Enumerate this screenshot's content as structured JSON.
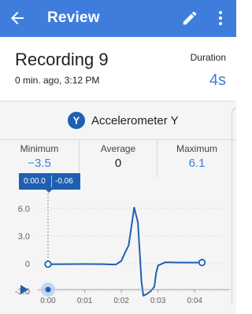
{
  "appbar": {
    "title": "Review",
    "back_icon": "arrow-back-icon",
    "edit_icon": "pencil-icon",
    "more_icon": "more-vert-icon",
    "color": "#3f7ddd"
  },
  "recording": {
    "title": "Recording 9",
    "time": "0 min. ago, 3:12 PM",
    "duration_label": "Duration",
    "duration_value": "4s"
  },
  "sensor": {
    "name": "Accelerometer Y",
    "icon_letter": "Y"
  },
  "stats": {
    "minimum_label": "Minimum",
    "minimum_value": "−3.5",
    "average_label": "Average",
    "average_value": "0",
    "maximum_label": "Maximum",
    "maximum_value": "6.1"
  },
  "tooltip": {
    "time": "0:00.0",
    "value": "-0.06"
  },
  "playback": {
    "play_icon": "play-icon",
    "position_seconds": 0
  },
  "chart_data": {
    "type": "line",
    "x_unit": "seconds",
    "x_tick_labels": [
      "0:00",
      "0:01",
      "0:02",
      "0:03",
      "0:04"
    ],
    "x_ticks": [
      0,
      1,
      2,
      3,
      4
    ],
    "y_tick_labels": [
      "6.0",
      "3.0",
      "0",
      "-3.0"
    ],
    "y_ticks": [
      6,
      3,
      0,
      -3
    ],
    "xlim": [
      0,
      4.5
    ],
    "ylim": [
      -4.2,
      7.2
    ],
    "grid": "horizontal-dotted",
    "series": [
      {
        "color": "#1f5fb3",
        "x": [
          0.0,
          0.5,
          1.0,
          1.5,
          1.85,
          2.0,
          2.1,
          2.2,
          2.35,
          2.45,
          2.55,
          2.6,
          2.7,
          2.8,
          2.9,
          2.95,
          3.0,
          3.2,
          3.6,
          4.0,
          4.2
        ],
        "y": [
          -0.06,
          -0.05,
          -0.04,
          -0.05,
          -0.1,
          0.3,
          1.2,
          2.0,
          6.1,
          4.5,
          -2.0,
          -3.5,
          -3.3,
          -3.0,
          -2.5,
          -1.0,
          -0.2,
          0.15,
          0.12,
          0.12,
          0.12
        ]
      }
    ]
  }
}
